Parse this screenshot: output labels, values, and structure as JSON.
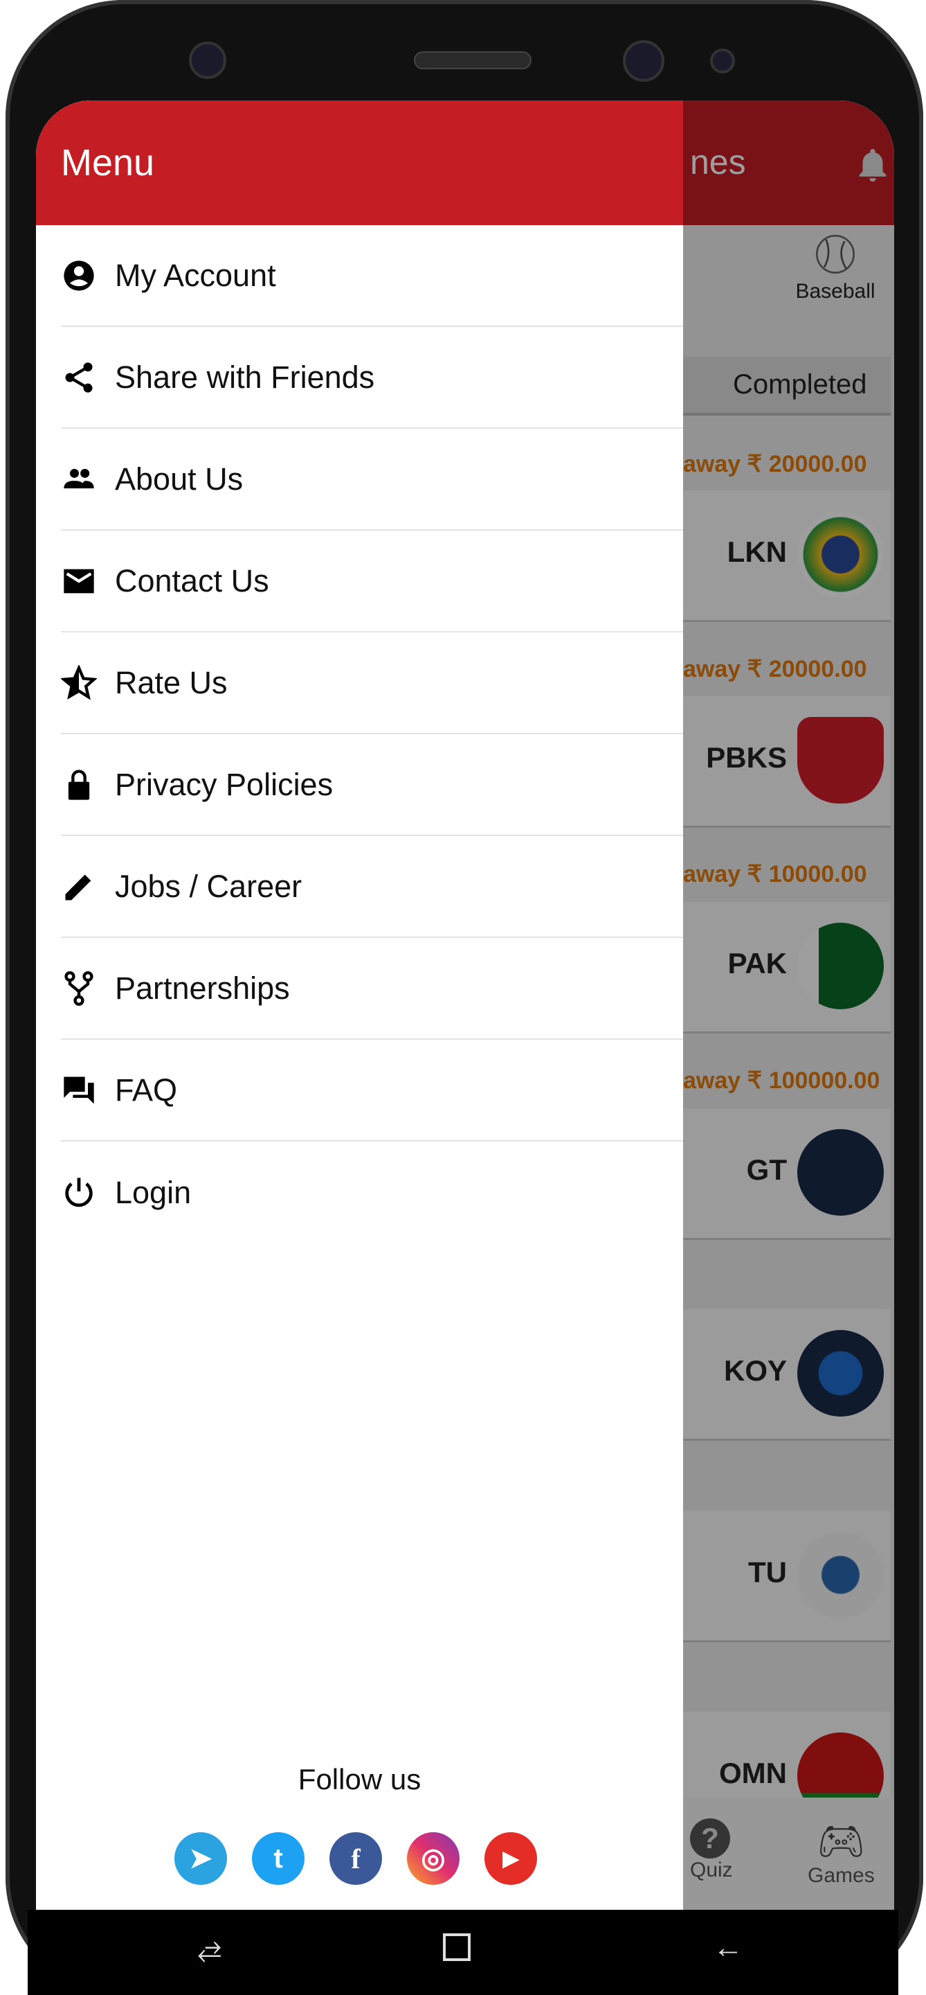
{
  "drawer": {
    "title": "Menu",
    "items": [
      {
        "label": "My Account",
        "icon": "account-circle-icon"
      },
      {
        "label": "Share with Friends",
        "icon": "share-icon"
      },
      {
        "label": "About Us",
        "icon": "people-icon"
      },
      {
        "label": "Contact Us",
        "icon": "mail-icon"
      },
      {
        "label": "Rate Us",
        "icon": "star-half-icon"
      },
      {
        "label": "Privacy Policies",
        "icon": "lock-icon"
      },
      {
        "label": "Jobs / Career",
        "icon": "pencil-icon"
      },
      {
        "label": "Partnerships",
        "icon": "fork-icon"
      },
      {
        "label": "FAQ",
        "icon": "forum-icon"
      },
      {
        "label": "Login",
        "icon": "power-icon"
      }
    ],
    "follow_label": "Follow us",
    "socials": [
      {
        "name": "telegram",
        "glyph": "➤",
        "color": "#2aa3e0"
      },
      {
        "name": "twitter",
        "glyph": "t",
        "color": "#1da1f2"
      },
      {
        "name": "facebook",
        "glyph": "f",
        "color": "#3b5998"
      },
      {
        "name": "instagram",
        "glyph": "◎",
        "color": "#c13584"
      },
      {
        "name": "youtube",
        "glyph": "▶",
        "color": "#e52d27"
      }
    ]
  },
  "background": {
    "title": "nes",
    "sport": "Baseball",
    "tab": "Completed",
    "prizes": [
      "away ₹ 20000.00",
      "away ₹ 20000.00",
      "away ₹ 10000.00",
      "away ₹ 100000.00"
    ],
    "teams": [
      "LKN",
      "PBKS",
      "PAK",
      "GT",
      "KOY",
      "TU",
      "OMN"
    ],
    "bottom_nav": [
      "Quiz",
      "Games"
    ]
  },
  "colors": {
    "brand": "#c41e24",
    "prize": "#e07a10"
  }
}
